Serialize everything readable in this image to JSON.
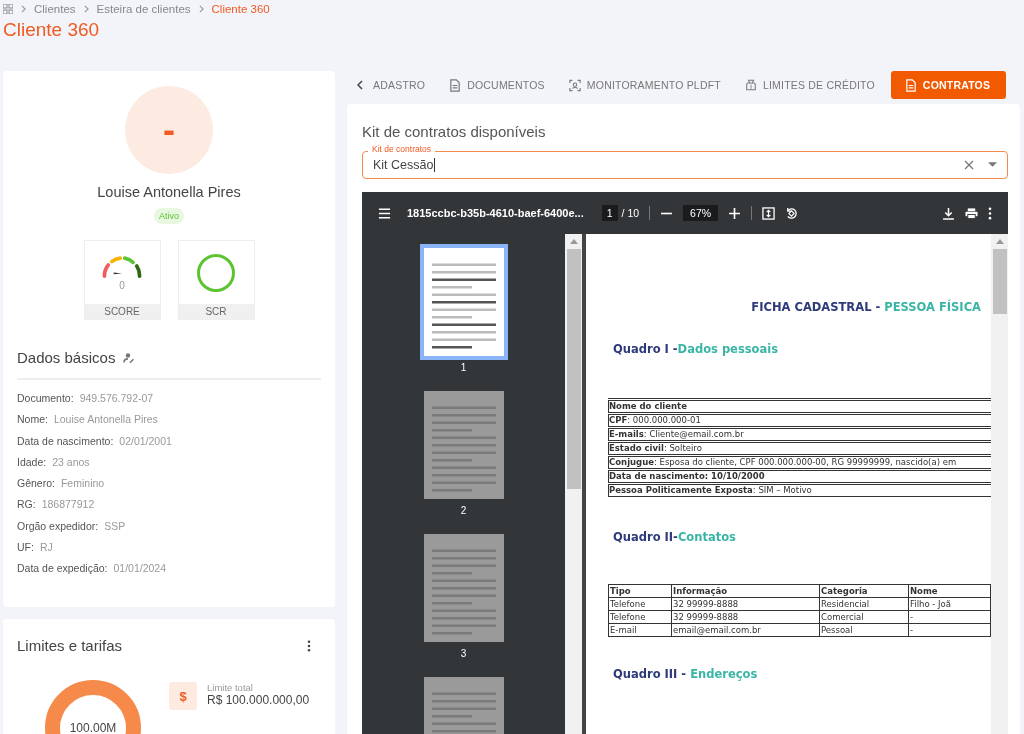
{
  "breadcrumb": [
    {
      "label": "Clientes",
      "current": false
    },
    {
      "label": "Esteira de clientes",
      "current": false
    },
    {
      "label": "Cliente 360",
      "current": true
    }
  ],
  "page_title": "Cliente 360",
  "profile": {
    "avatar_text": "-",
    "name": "Louise Antonella Pires",
    "status": "Ativo",
    "indicators": [
      {
        "kind": "gauge",
        "value": "0",
        "label": "SCORE"
      },
      {
        "kind": "ring",
        "label": "SCR"
      }
    ]
  },
  "basic_data": {
    "title": "Dados básicos",
    "fields": [
      {
        "label": "Documento:",
        "value": "949.576.792-07"
      },
      {
        "label": "Nome:",
        "value": "Louise Antonella Pires"
      },
      {
        "label": "Data de nascimento:",
        "value": "02/01/2001"
      },
      {
        "label": "Idade:",
        "value": "23 anos"
      },
      {
        "label": "Gênero:",
        "value": "Feminino"
      },
      {
        "label": "RG:",
        "value": "186877912"
      },
      {
        "label": "Orgão expedidor:",
        "value": "SSP"
      },
      {
        "label": "UF:",
        "value": "RJ"
      },
      {
        "label": "Data de expedição:",
        "value": "01/01/2024"
      }
    ]
  },
  "limits": {
    "title": "Limites e tarifas",
    "donut_label": "100.00M",
    "icon_glyph": "$",
    "total_label": "Limite total",
    "total_value": "R$ 100.000.000,00"
  },
  "tabs": [
    {
      "label": "ADASTRO",
      "selected": false
    },
    {
      "label": "DOCUMENTOS",
      "selected": false
    },
    {
      "label": "MONITORAMENTO PLDFT",
      "selected": false
    },
    {
      "label": "LIMITES DE CRÉDITO",
      "selected": false
    },
    {
      "label": "CONTRATOS",
      "selected": true
    }
  ],
  "panel": {
    "title": "Kit de contratos disponíveis",
    "field_label": "Kit de contratos",
    "field_value": "Kit Cessão"
  },
  "viewer": {
    "file_name": "1815ccbc-b35b-4610-baef-6400e...",
    "page": "1",
    "page_total": "/ 10",
    "zoom": "67%",
    "thumbnails": [
      {
        "label": "1",
        "selected": true
      },
      {
        "label": "2",
        "selected": false
      },
      {
        "label": "3",
        "selected": false
      },
      {
        "selected": false
      }
    ],
    "document": {
      "title": "FICHA CADASTRAL - ",
      "title_highlight": "PESSOA FÍSICA",
      "section_1": {
        "prefix": "Quadro I -",
        "highlight": "Dados pessoais"
      },
      "personal_rows": [
        {
          "text": "Nome do cliente",
          "bold": true
        },
        {
          "text": "**CPF**: 000.000.000-01",
          "bold": false
        },
        {
          "text": "**E-mails**: Cliente@email.com.br",
          "bold": false
        },
        {
          "text": "**Estado civil**: Solteiro",
          "bold": false
        },
        {
          "text": "**Conjugue**: Esposa do cliente, CPF 000.000.000-00, RG 99999999, nascido(a) em",
          "bold": false
        },
        {
          "text": "Data de nascimento: 10/10/2000",
          "bold": true
        },
        {
          "text": "**Pessoa Politicamente Exposta**: SIM – Motivo",
          "bold": false
        }
      ],
      "section_2": {
        "prefix": "Quadro II-",
        "highlight": "Contatos"
      },
      "contacts": {
        "columns": [
          "Tipo",
          "Informação",
          "Categoria",
          "Nome"
        ],
        "rows": [
          [
            "Telefone",
            "32 99999-8888",
            "Residencial",
            "Filho - Joã"
          ],
          [
            "Telefone",
            "32 99999-8888",
            "Comercial",
            "-"
          ],
          [
            "E-mail",
            "email@email.com.br",
            "Pessoal",
            "-"
          ]
        ]
      },
      "section_3": {
        "prefix": "Quadro III - ",
        "highlight": "Endereços"
      }
    }
  }
}
